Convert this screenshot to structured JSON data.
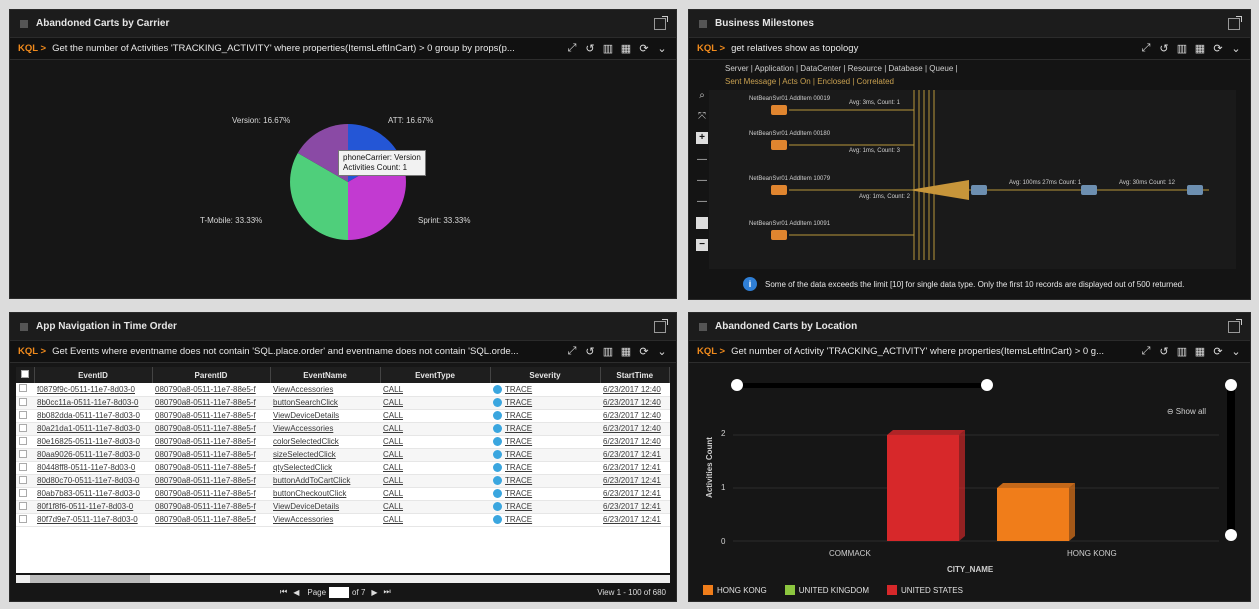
{
  "panels": {
    "carrier": {
      "title": "Abandoned Carts by Carrier",
      "kql": "KQL >",
      "query": "Get the number of Activities 'TRACKING_ACTIVITY' where properties(ItemsLeftInCart) > 0 group by props(p..."
    },
    "milestones": {
      "title": "Business Milestones",
      "kql": "KQL >",
      "query": "get relatives show as topology",
      "legend_top": "Server | Application | DataCenter | Resource | Database | Queue |",
      "legend_bottom": "Sent Message | Acts On | Enclosed | Correlated",
      "info": "Some of the data exceeds the limit [10] for single data type. Only the first 10 records are displayed out of 500 returned."
    },
    "navigation": {
      "title": "App Navigation in Time Order",
      "kql": "KQL >",
      "query": "Get Events where eventname does not contain 'SQL.place.order' and eventname does not contain 'SQL.orde..."
    },
    "location": {
      "title": "Abandoned Carts by Location",
      "kql": "KQL >",
      "query": "Get number of Activity 'TRACKING_ACTIVITY' where properties(ItemsLeftInCart) > 0 g..."
    }
  },
  "pie": {
    "labels": {
      "version": "Version: 16.67%",
      "att": "ATT: 16.67%",
      "tmobile": "T-Mobile: 33.33%",
      "sprint": "Sprint: 33.33%"
    },
    "tooltip_line1": "phoneCarrier: Version",
    "tooltip_line2": "Activities Count: 1",
    "colors": {
      "att": "#2456d6",
      "sprint": "#c23ad1",
      "tmobile": "#4fcf7b",
      "version": "#8a4aa5"
    }
  },
  "topology": {
    "nodes": [
      "NetBeanSvr01 AddItem 00019",
      "NetBeanSvr01 AddItem 00180",
      "NetBeanSvr01 AddItem 10079",
      "NetBeanSvr01 AddItem 10091",
      "Avg: 3ms, Count: 1",
      "Avg: 1ms, Count: 3",
      "Avg: 1ms, Count: 2",
      "Avg: 100ms 27ms Count: 1",
      "Avg: 30ms Count: 12"
    ]
  },
  "table": {
    "columns": [
      "EventID",
      "ParentID",
      "EventName",
      "EventType",
      "Severity",
      "StartTime"
    ],
    "rows": [
      [
        "f0879f9c-0511-11e7-8d03-0",
        "080790a8-0511-11e7-88e5-f",
        "ViewAccessories",
        "CALL",
        "TRACE",
        "6/23/2017 12:40"
      ],
      [
        "8b0cc11a-0511-11e7-8d03-0",
        "080790a8-0511-11e7-88e5-f",
        "buttonSearchClick",
        "CALL",
        "TRACE",
        "6/23/2017 12:40"
      ],
      [
        "8b082dda-0511-11e7-8d03-0",
        "080790a8-0511-11e7-88e5-f",
        "ViewDeviceDetails",
        "CALL",
        "TRACE",
        "6/23/2017 12:40"
      ],
      [
        "80a21da1-0511-11e7-8d03-0",
        "080790a8-0511-11e7-88e5-f",
        "ViewAccessories",
        "CALL",
        "TRACE",
        "6/23/2017 12:40"
      ],
      [
        "80e16825-0511-11e7-8d03-0",
        "080790a8-0511-11e7-88e5-f",
        "colorSelectedClick",
        "CALL",
        "TRACE",
        "6/23/2017 12:40"
      ],
      [
        "80aa9026-0511-11e7-8d03-0",
        "080790a8-0511-11e7-88e5-f",
        "sizeSelectedClick",
        "CALL",
        "TRACE",
        "6/23/2017 12:41"
      ],
      [
        "80448ff8-0511-11e7-8d03-0",
        "080790a8-0511-11e7-88e5-f",
        "qtySelectedClick",
        "CALL",
        "TRACE",
        "6/23/2017 12:41"
      ],
      [
        "80d80c70-0511-11e7-8d03-0",
        "080790a8-0511-11e7-88e5-f",
        "buttonAddToCartClick",
        "CALL",
        "TRACE",
        "6/23/2017 12:41"
      ],
      [
        "80ab7b83-0511-11e7-8d03-0",
        "080790a8-0511-11e7-88e5-f",
        "buttonCheckoutClick",
        "CALL",
        "TRACE",
        "6/23/2017 12:41"
      ],
      [
        "80f1f8f6-0511-11e7-8d03-0",
        "080790a8-0511-11e7-88e5-f",
        "ViewDeviceDetails",
        "CALL",
        "TRACE",
        "6/23/2017 12:41"
      ],
      [
        "80f7d9e7-0511-11e7-8d03-0",
        "080790a8-0511-11e7-88e5-f",
        "ViewAccessories",
        "CALL",
        "TRACE",
        "6/23/2017 12:41"
      ]
    ],
    "pager_page_label": "Page",
    "pager_page_value": "1",
    "pager_of": "of 7",
    "pager_view": "View 1 - 100 of 680"
  },
  "chart_data": {
    "type": "bar",
    "categories": [
      "COMMACK",
      "HONG KONG"
    ],
    "series": [
      {
        "name": "UNITED STATES",
        "values": [
          2,
          0
        ]
      },
      {
        "name": "HONG KONG",
        "values": [
          0,
          1
        ]
      }
    ],
    "xlabel": "CITY_NAME",
    "ylabel": "Activities Count",
    "ylim": [
      0,
      2
    ],
    "yticks": [
      "0",
      "1",
      "2"
    ],
    "show_all": "Show all",
    "legend": [
      {
        "label": "HONG KONG",
        "color": "#f07d1a"
      },
      {
        "label": "UNITED KINGDOM",
        "color": "#8cc63f"
      },
      {
        "label": "UNITED STATES",
        "color": "#d7282a"
      }
    ]
  }
}
